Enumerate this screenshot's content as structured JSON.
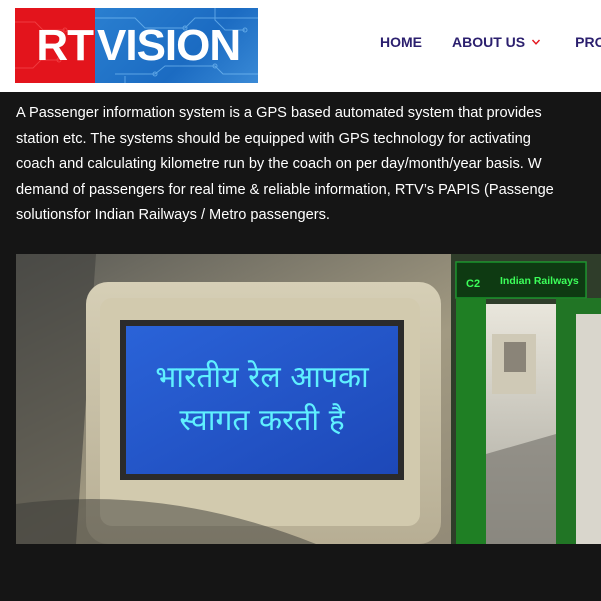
{
  "brand": {
    "logo_left": "RT",
    "logo_right": "VISION",
    "colors": {
      "red": "#e3141c",
      "blue": "#1f72c8",
      "nav": "#2b1f6e",
      "chevron": "#e3141c"
    }
  },
  "nav": {
    "items": [
      {
        "label": "HOME"
      },
      {
        "label": "ABOUT US",
        "icon": "chevron-down-icon"
      },
      {
        "label": "PRO"
      }
    ]
  },
  "content": {
    "paragraph_lines": [
      "A Passenger information system is a GPS based automated system that provides",
      "station etc. The systems should be equipped with GPS technology for activating",
      "coach and calculating kilometre run by the coach on per day/month/year basis. W",
      "demand of passengers for real time & reliable information, RTV’s PAPIS (Passenge",
      "solutionsfor Indian Railways / Metro passengers."
    ]
  },
  "photo": {
    "screen_line1": "भारतीय रेल आपका",
    "screen_line2": "स्वागत करती है",
    "sign_code": "C2",
    "sign_text": "Indian Railways"
  }
}
